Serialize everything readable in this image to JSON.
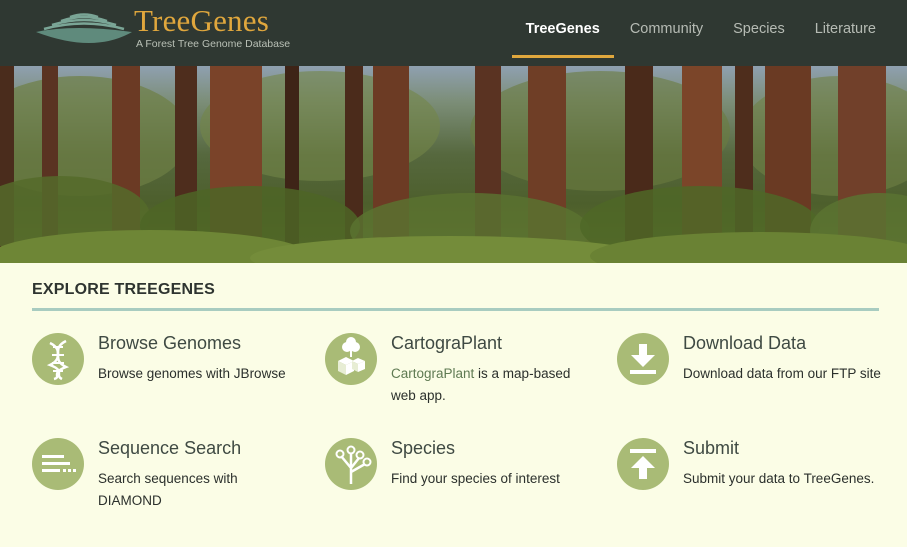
{
  "header": {
    "logo_title": "TreeGenes",
    "logo_subtitle": "A Forest Tree Genome Database",
    "nav": [
      {
        "label": "TreeGenes",
        "active": true
      },
      {
        "label": "Community",
        "active": false
      },
      {
        "label": "Species",
        "active": false
      },
      {
        "label": "Literature",
        "active": false
      }
    ]
  },
  "hero": {
    "image": "redwood-forest-photo"
  },
  "explore": {
    "title": "EXPLORE TREEGENES",
    "cards": [
      {
        "title": "Browse Genomes",
        "icon": "dna-icon",
        "description": "Browse genomes with JBrowse"
      },
      {
        "title": "CartograPlant",
        "icon": "tree-blocks-icon",
        "description_link": "CartograPlant",
        "description_rest": " is a map-based web app."
      },
      {
        "title": "Download Data",
        "icon": "download-icon",
        "description": "Download data from our FTP site"
      },
      {
        "title": "Sequence Search",
        "icon": "sequence-lines-icon",
        "description": "Search sequences with DIAMOND"
      },
      {
        "title": "Species",
        "icon": "branch-icon",
        "description": "Find your species of interest"
      },
      {
        "title": "Submit",
        "icon": "upload-icon",
        "description": "Submit your data to TreeGenes."
      }
    ]
  },
  "colors": {
    "header_bg": "#2f3832",
    "accent": "#e0a73d",
    "icon_green": "#a9bb76",
    "page_bg": "#fbfde6",
    "rule": "#a8ccc0"
  }
}
